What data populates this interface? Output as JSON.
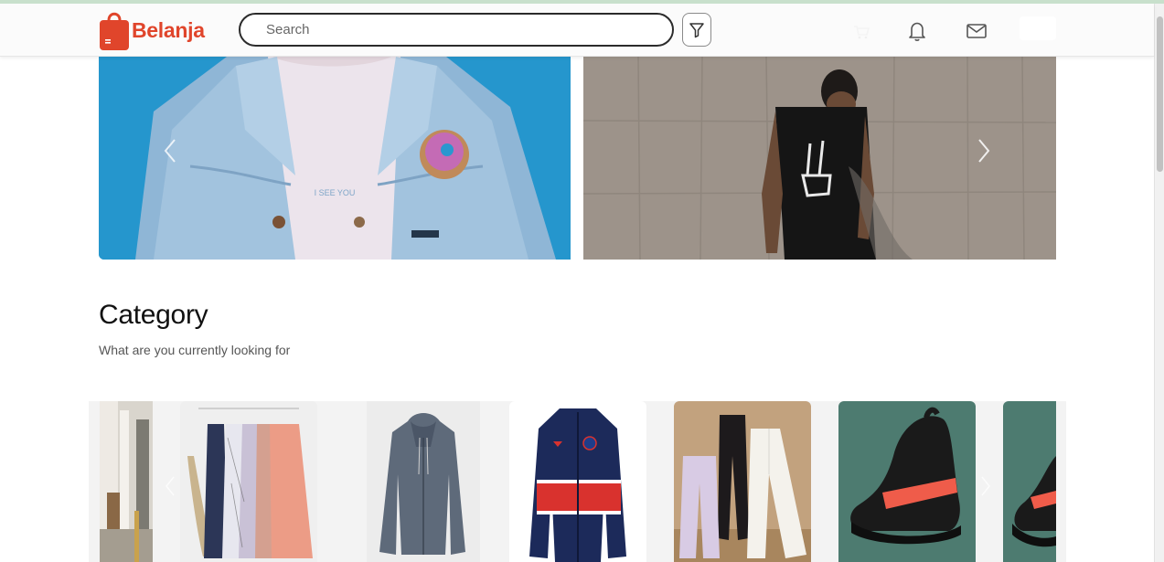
{
  "brand": {
    "name": "Belanja",
    "color": "#e0452b"
  },
  "search": {
    "placeholder": "Search",
    "value": ""
  },
  "header_icons": [
    "filter-icon",
    "cart-icon",
    "bell-icon",
    "mail-icon"
  ],
  "banners": [
    {
      "name": "denim-jacket-banner",
      "printed_text": "I SEE YOU"
    },
    {
      "name": "skeleton-tshirt-banner"
    }
  ],
  "category": {
    "title": "Category",
    "subtitle": "What are you currently looking for",
    "items": [
      "street",
      "dresses",
      "hoodie",
      "jacket",
      "pants",
      "shoes",
      "shoes"
    ]
  }
}
